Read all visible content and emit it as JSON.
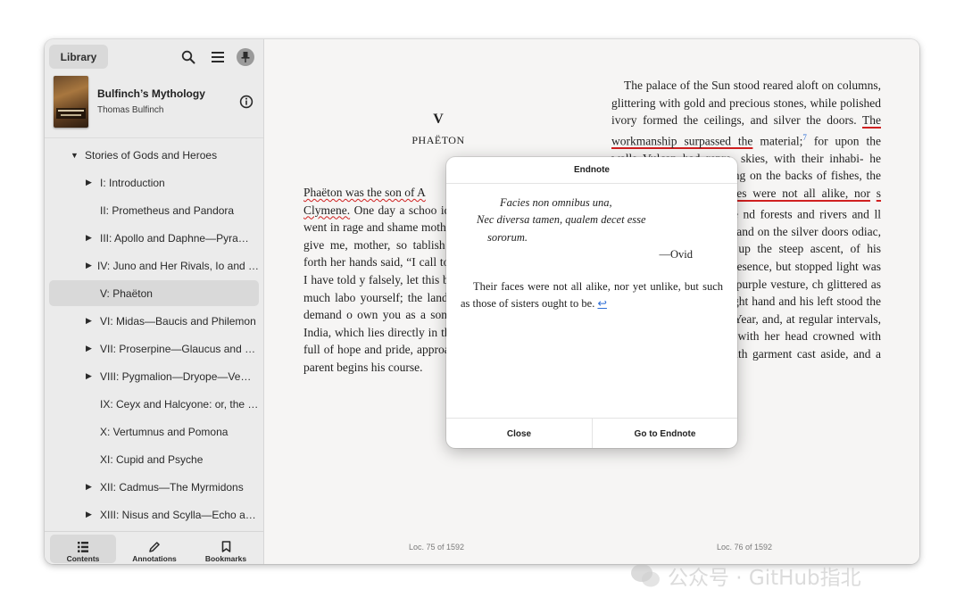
{
  "sidebar": {
    "library_label": "Library",
    "book": {
      "title": "Bulfinch’s Mythology",
      "author": "Thomas Bulfinch"
    },
    "toc": [
      {
        "label": "Stories of Gods and Heroes",
        "expander": "expanded",
        "level": 0
      },
      {
        "label": "I: Introduction",
        "expander": "collapsed",
        "level": 1
      },
      {
        "label": "II: Prometheus and Pandora",
        "expander": "none",
        "level": 1
      },
      {
        "label": "III: Apollo and Daphne—Pyra…",
        "expander": "collapsed",
        "level": 1
      },
      {
        "label": "IV: Juno and Her Rivals, Io and …",
        "expander": "collapsed",
        "level": 1
      },
      {
        "label": "V: Phaëton",
        "expander": "none",
        "level": 1,
        "selected": true
      },
      {
        "label": "VI: Midas—Baucis and Philemon",
        "expander": "collapsed",
        "level": 1
      },
      {
        "label": "VII: Proserpine—Glaucus and …",
        "expander": "collapsed",
        "level": 1
      },
      {
        "label": "VIII: Pygmalion—Dryope—Ve…",
        "expander": "collapsed",
        "level": 1
      },
      {
        "label": "IX: Ceyx and Halcyone: or, the …",
        "expander": "none",
        "level": 1
      },
      {
        "label": "X: Vertumnus and Pomona",
        "expander": "none",
        "level": 1
      },
      {
        "label": "XI: Cupid and Psyche",
        "expander": "none",
        "level": 1
      },
      {
        "label": "XII: Cadmus—The Myrmidons",
        "expander": "collapsed",
        "level": 1
      },
      {
        "label": "XIII: Nisus and Scylla—Echo a…",
        "expander": "collapsed",
        "level": 1
      }
    ],
    "tabs": [
      {
        "label": "Contents",
        "icon": "list-icon",
        "active": true
      },
      {
        "label": "Annotations",
        "icon": "pencil-icon",
        "active": false
      },
      {
        "label": "Bookmarks",
        "icon": "bookmark-icon",
        "active": false
      }
    ]
  },
  "reader": {
    "left_page": {
      "chapter_number": "V",
      "chapter_title": "PHAËTON",
      "seg_u1": "Phaëton was the son of A",
      "seg_u2": "Clymene.",
      "seg_rest": " One day a schoo idea of his being the son o went in rage and shame mother. “If,” said he, “I a birth, give me, mother, so tablish my claim to t stretched forth her hands said, “I call to witness the upon us, that I have told y falsely, let this be the last But it needs not much labo yourself; the land whence to ours. Go and demand o own you as a son.” Phaëto He travelled to India, which lies directly in the regions of sunrise; and, full of hope and pride, approached the goal whence his parent begins his course.",
      "location": "Loc. 75 of 1592"
    },
    "right_page": {
      "seg1": "The palace of the Sun stood reared aloft on columns, glittering with gold and precious stones, while polished ivory formed the ceilings, and silver the doors. ",
      "seg2": "The workmanship surpassed the",
      "seg3": " material;",
      "fn1": "7",
      "seg4": " for upon the walls Vulcan had repre- skies, with their inhabi- he nymphs, some sporting ing on the backs of fishes, the rocks and dried their ",
      "seg5": "aces were not all alike, nor",
      "seg6": "s sisters’ ought to be.",
      "fn2": "8",
      "seg7": " The nd forests and rivers and ll was carved the likeness ; and on the silver doors odiac, six on each side. nced up the steep ascent, of his disputed father. He nal presence, but stopped light was more than he rrayed in a purple vesture, ch glittered as with diamonds. On his right hand and his left stood the Day, the Month, and the Year, and, at regular intervals, the Hours. Spring stood with her head crowned with flowers, and Summer, with garment cast aside, and a garland formed of spears",
      "location": "Loc. 76 of 1592"
    }
  },
  "endnote_dialog": {
    "title": "Endnote",
    "verse_line1": "Facies non omnibus una,",
    "verse_line2": "Nec diversa tamen, qualem decet esse",
    "verse_line3": "sororum.",
    "attribution": "—Ovid",
    "translation": "Their faces were not all alike, nor yet unlike, but such as those of sisters ought to be.",
    "back_link": "↩",
    "close_label": "Close",
    "goto_label": "Go to Endnote"
  },
  "watermark": {
    "text": "公众号 · GitHub指北"
  }
}
